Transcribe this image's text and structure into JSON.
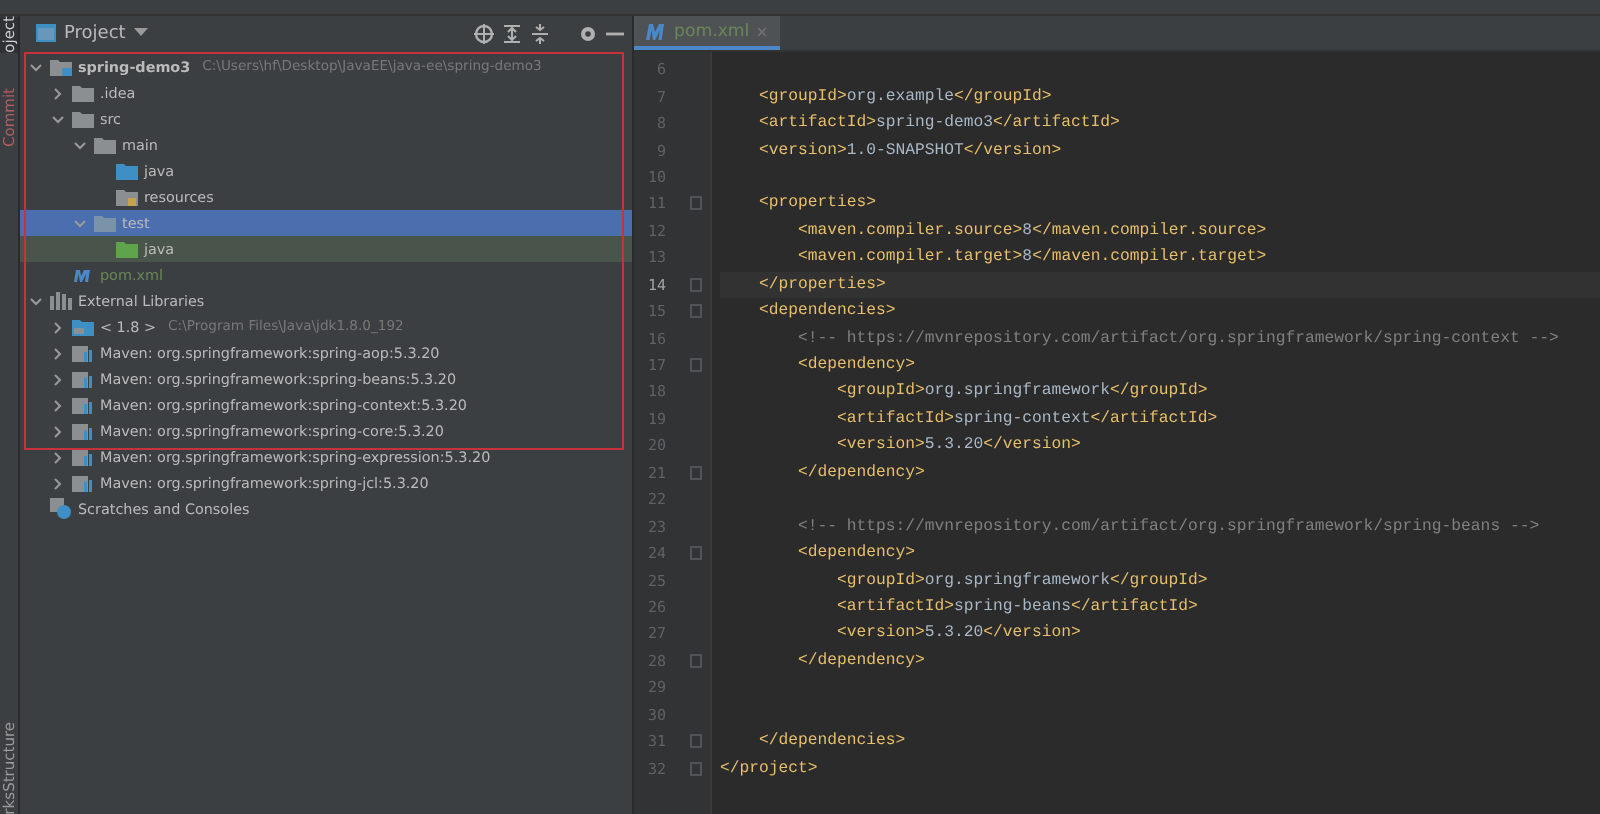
{
  "tool_strip": [
    {
      "label": "oject",
      "selected": true
    },
    {
      "label": "Commit",
      "selected": false
    },
    {
      "label": "Structure",
      "selected": false
    },
    {
      "label": "rks",
      "selected": false
    }
  ],
  "project_panel": {
    "title": "Project",
    "tree": [
      {
        "label": "spring-demo3",
        "hint": "C:\\Users\\hf\\Desktop\\JavaEE\\java-ee\\spring-demo3",
        "kind": "module",
        "expanded": true,
        "selected": false,
        "children": [
          {
            "label": ".idea",
            "kind": "folder",
            "expanded": false,
            "selected": false
          },
          {
            "label": "src",
            "kind": "folder",
            "expanded": true,
            "selected": false,
            "children": [
              {
                "label": "main",
                "kind": "folder",
                "expanded": true,
                "selected": false,
                "children": [
                  {
                    "label": "java",
                    "kind": "source-folder",
                    "selected": false
                  },
                  {
                    "label": "resources",
                    "kind": "resources-folder",
                    "selected": false
                  }
                ]
              },
              {
                "label": "test",
                "kind": "test-folder",
                "expanded": true,
                "selected": true,
                "children": [
                  {
                    "label": "java",
                    "kind": "test-source-folder",
                    "selected": false
                  }
                ]
              }
            ]
          },
          {
            "label": "pom.xml",
            "kind": "pom",
            "selected": false
          }
        ]
      },
      {
        "label": "External Libraries",
        "kind": "libraries",
        "expanded": true,
        "selected": false,
        "children": [
          {
            "label": "< 1.8 >",
            "hint": "C:\\Program Files\\Java\\jdk1.8.0_192",
            "kind": "jdk",
            "expanded": false,
            "selected": false
          },
          {
            "label": "Maven: org.springframework:spring-aop:5.3.20",
            "kind": "maven",
            "expanded": false,
            "selected": false
          },
          {
            "label": "Maven: org.springframework:spring-beans:5.3.20",
            "kind": "maven",
            "expanded": false,
            "selected": false
          },
          {
            "label": "Maven: org.springframework:spring-context:5.3.20",
            "kind": "maven",
            "expanded": false,
            "selected": false
          },
          {
            "label": "Maven: org.springframework:spring-core:5.3.20",
            "kind": "maven",
            "expanded": false,
            "selected": false
          },
          {
            "label": "Maven: org.springframework:spring-expression:5.3.20",
            "kind": "maven",
            "expanded": false,
            "selected": false
          },
          {
            "label": "Maven: org.springframework:spring-jcl:5.3.20",
            "kind": "maven",
            "expanded": false,
            "selected": false
          }
        ]
      },
      {
        "label": "Scratches and Consoles",
        "kind": "scratches",
        "selected": false
      }
    ]
  },
  "editor": {
    "tabs": [
      {
        "label": "pom.xml",
        "selected": true
      }
    ],
    "lines": [
      {
        "number": "6",
        "kind": "code",
        "current": false,
        "fold": false
      },
      {
        "number": "7",
        "text": "    <groupId>org.example</groupId>",
        "kind": "code",
        "current": false,
        "fold": false
      },
      {
        "number": "8",
        "text": "    <artifactId>spring-demo3</artifactId>",
        "kind": "code",
        "current": false,
        "fold": false
      },
      {
        "number": "9",
        "text": "    <version>1.0-SNAPSHOT</version>",
        "kind": "code",
        "current": false,
        "fold": false
      },
      {
        "number": "10",
        "kind": "code",
        "current": false,
        "fold": false
      },
      {
        "number": "11",
        "text": "    <properties>",
        "kind": "code",
        "current": false,
        "fold": true
      },
      {
        "number": "12",
        "text": "        <maven.compiler.source>8</maven.compiler.source>",
        "kind": "code",
        "current": false,
        "fold": false
      },
      {
        "number": "13",
        "text": "        <maven.compiler.target>8</maven.compiler.target>",
        "kind": "code",
        "current": false,
        "fold": false
      },
      {
        "number": "14",
        "text": "    </properties>",
        "kind": "code",
        "current": true,
        "fold": true
      },
      {
        "number": "15",
        "text": "    <dependencies>",
        "kind": "code",
        "current": false,
        "fold": true
      },
      {
        "number": "16",
        "text": "        <!-- https://mvnrepository.com/artifact/org.springframework/spring-context -->",
        "kind": "comment",
        "current": false,
        "fold": false
      },
      {
        "number": "17",
        "text": "        <dependency>",
        "kind": "code",
        "current": false,
        "fold": true
      },
      {
        "number": "18",
        "text": "            <groupId>org.springframework</groupId>",
        "kind": "code",
        "current": false,
        "fold": false
      },
      {
        "number": "19",
        "text": "            <artifactId>spring-context</artifactId>",
        "kind": "code",
        "current": false,
        "fold": false
      },
      {
        "number": "20",
        "text": "            <version>5.3.20</version>",
        "kind": "code",
        "current": false,
        "fold": false
      },
      {
        "number": "21",
        "text": "        </dependency>",
        "kind": "code",
        "current": false,
        "fold": true
      },
      {
        "number": "22",
        "kind": "code",
        "current": false,
        "fold": false
      },
      {
        "number": "23",
        "text": "        <!-- https://mvnrepository.com/artifact/org.springframework/spring-beans -->",
        "kind": "comment",
        "current": false,
        "fold": false
      },
      {
        "number": "24",
        "text": "        <dependency>",
        "kind": "code",
        "current": false,
        "fold": true
      },
      {
        "number": "25",
        "text": "            <groupId>org.springframework</groupId>",
        "kind": "code",
        "current": false,
        "fold": false
      },
      {
        "number": "26",
        "text": "            <artifactId>spring-beans</artifactId>",
        "kind": "code",
        "current": false,
        "fold": false
      },
      {
        "number": "27",
        "text": "            <version>5.3.20</version>",
        "kind": "code",
        "current": false,
        "fold": false
      },
      {
        "number": "28",
        "text": "        </dependency>",
        "kind": "code",
        "current": false,
        "fold": true
      },
      {
        "number": "29",
        "kind": "code",
        "current": false,
        "fold": false
      },
      {
        "number": "30",
        "kind": "code",
        "current": false,
        "fold": false
      },
      {
        "number": "31",
        "text": "    </dependencies>",
        "kind": "code",
        "current": false,
        "fold": true
      },
      {
        "number": "32",
        "text": "</project>",
        "kind": "code",
        "current": false,
        "fold": true
      }
    ]
  }
}
